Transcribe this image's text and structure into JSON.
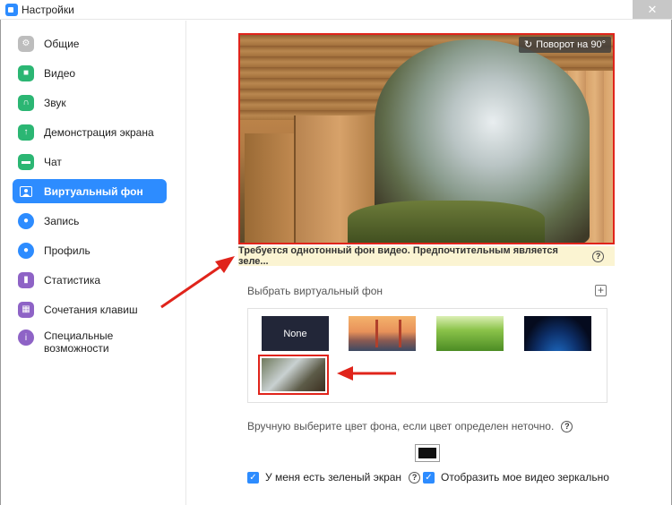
{
  "window": {
    "title": "Настройки",
    "close_glyph": "✕"
  },
  "sidebar": {
    "items": [
      {
        "label": "Общие",
        "icon": "gear-icon",
        "color": "#9e9e9e"
      },
      {
        "label": "Видео",
        "icon": "video-icon",
        "color": "#2bb673"
      },
      {
        "label": "Звук",
        "icon": "headphones-icon",
        "color": "#2bb673"
      },
      {
        "label": "Демонстрация экрана",
        "icon": "share-screen-icon",
        "color": "#2bb673"
      },
      {
        "label": "Чат",
        "icon": "chat-icon",
        "color": "#2bb673"
      },
      {
        "label": "Виртуальный фон",
        "icon": "virtual-background-icon",
        "color": "#2d8cff",
        "active": true
      },
      {
        "label": "Запись",
        "icon": "record-icon",
        "color": "#2d8cff"
      },
      {
        "label": "Профиль",
        "icon": "profile-icon",
        "color": "#2d8cff"
      },
      {
        "label": "Статистика",
        "icon": "statistics-icon",
        "color": "#8e63c6"
      },
      {
        "label": "Сочетания клавиш",
        "icon": "keyboard-icon",
        "color": "#8e63c6"
      },
      {
        "label": "Специальные возможности",
        "icon": "accessibility-icon",
        "color": "#8e63c6"
      }
    ]
  },
  "preview": {
    "rotate_label": "Поворот на 90°",
    "notice": "Требуется однотонный фон видео. Предпочтительным является зеле..."
  },
  "backgrounds": {
    "label": "Выбрать виртуальный фон",
    "add_glyph": "+",
    "none_label": "None"
  },
  "manual_color": {
    "label": "Вручную выберите цвет фона, если цвет определен неточно.",
    "swatch_color": "#111111"
  },
  "options": {
    "green_screen": "У меня есть зеленый экран",
    "mirror": "Отобразить мое видео зеркально"
  },
  "annotation_color": "#e0241b"
}
